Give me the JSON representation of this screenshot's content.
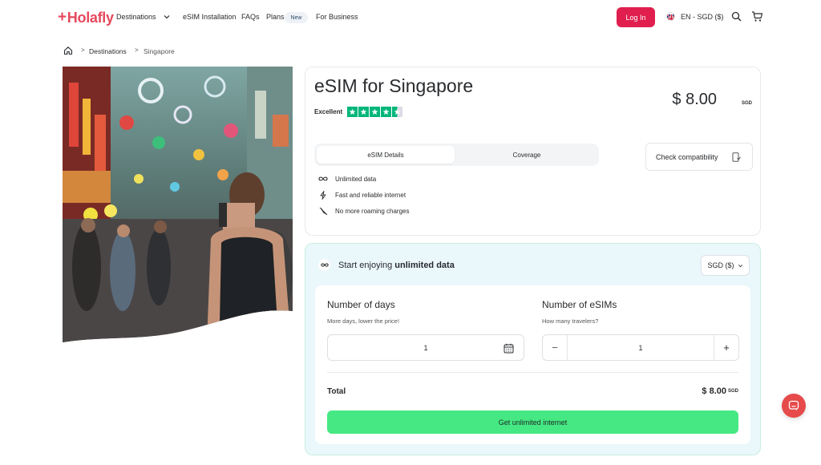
{
  "header": {
    "logo": "Holafly",
    "nav": {
      "destinations": "Destinations",
      "esim_installation": "eSIM Installation",
      "faqs": "FAQs",
      "plans": "Plans",
      "plans_badge": "New",
      "for_business": "For Business"
    },
    "login_label": "Log In",
    "language_currency": "EN - SGD ($)",
    "icons": [
      "chevron-down-icon",
      "uk-flag-icon",
      "search-icon",
      "cart-icon"
    ]
  },
  "breadcrumb": {
    "items": [
      "Destinations",
      "Singapore"
    ],
    "separator": ">"
  },
  "product": {
    "title": "eSIM for Singapore",
    "rating_label": "Excellent",
    "stars": 4.5,
    "price": "$ 8.00",
    "price_currency": "SGD",
    "tabs": [
      "eSIM Details",
      "Coverage"
    ],
    "active_tab": "eSIM Details",
    "check_compatibility": "Check compatibility",
    "features": [
      {
        "icon": "infinity-icon",
        "label": "Unlimited data"
      },
      {
        "icon": "lightning-icon",
        "label": "Fast and reliable internet"
      },
      {
        "icon": "no-roaming-icon",
        "label": "No more roaming charges"
      }
    ]
  },
  "purchase": {
    "heading_prefix": "Start enjoying",
    "heading_bold": "unlimited data",
    "currency_select": "SGD ($)",
    "days": {
      "title": "Number of days",
      "subtitle": "More days, lower the price!",
      "value": "1"
    },
    "esims": {
      "title": "Number of eSIMs",
      "subtitle": "How many travelers?",
      "value": "1",
      "minus": "−",
      "plus": "+"
    },
    "total_label": "Total",
    "total_value": "$ 8.00",
    "total_currency": "SGD",
    "cta_label": "Get unlimited internet"
  },
  "colors": {
    "brand": "#E6485C",
    "login": "#E01F4E",
    "cta": "#45E882",
    "panel_bg": "#EAF7FB",
    "trustpilot": "#00B67A",
    "chat": "#E64A4A"
  }
}
